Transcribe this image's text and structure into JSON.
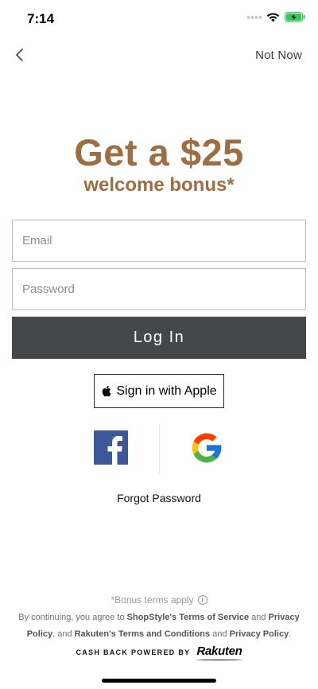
{
  "status_bar": {
    "time": "7:14",
    "battery_state": "charging",
    "battery_color": "#34c759"
  },
  "nav": {
    "back_icon": "chevron-left-icon",
    "not_now_label": "Not Now"
  },
  "promo": {
    "headline": "Get a $25",
    "subhead": "welcome bonus*",
    "accent_color": "#9c6e42"
  },
  "form": {
    "email_placeholder": "Email",
    "email_value": "",
    "password_placeholder": "Password",
    "password_value": "",
    "login_label": "Log In",
    "login_button_color": "#464749"
  },
  "social": {
    "apple_label": "Sign in with Apple",
    "facebook_icon": "facebook-icon",
    "facebook_color": "#3b5998",
    "google_icon": "google-icon"
  },
  "forgot_password_label": "Forgot Password",
  "footer": {
    "bonus_terms": "*Bonus terms apply",
    "legal": {
      "prefix": "By continuing, you agree to ",
      "shopstyle_terms": "ShopStyle's Terms of Service",
      "and_1": " and ",
      "privacy_1": "Privacy Policy",
      "mid": ", and ",
      "rakuten_terms": "Rakuten's Terms and Conditions",
      "and_2": " and ",
      "privacy_2": "Privacy Policy",
      "suffix": "."
    },
    "powered_by": "CASH BACK POWERED BY",
    "rakuten_logo": "Rakuten"
  }
}
